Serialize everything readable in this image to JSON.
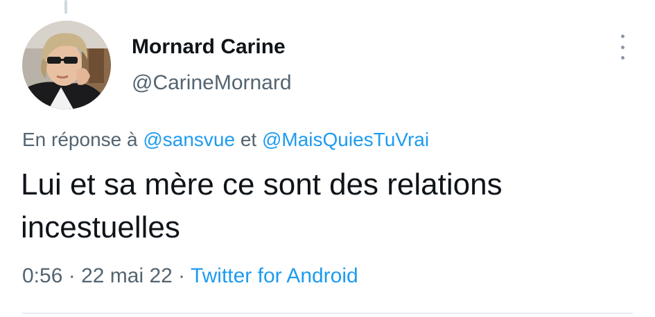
{
  "author": {
    "display_name": "Mornard Carine",
    "handle": "@CarineMornard"
  },
  "reply_context": {
    "prefix": "En réponse à ",
    "mention_1": "@sansvue",
    "connector": " et ",
    "mention_2": "@MaisQuiesTuVrai"
  },
  "tweet": {
    "text": "Lui et sa mère ce sont des relations incestuelles"
  },
  "meta": {
    "time": "0:56",
    "separator_1": " · ",
    "date": "22 mai 22",
    "separator_2": " · ",
    "source": "Twitter for Android"
  },
  "icons": {
    "more": "more-vertical-icon"
  },
  "colors": {
    "link": "#1d9bf0",
    "secondary_text": "#536471",
    "primary_text": "#0f1419"
  }
}
